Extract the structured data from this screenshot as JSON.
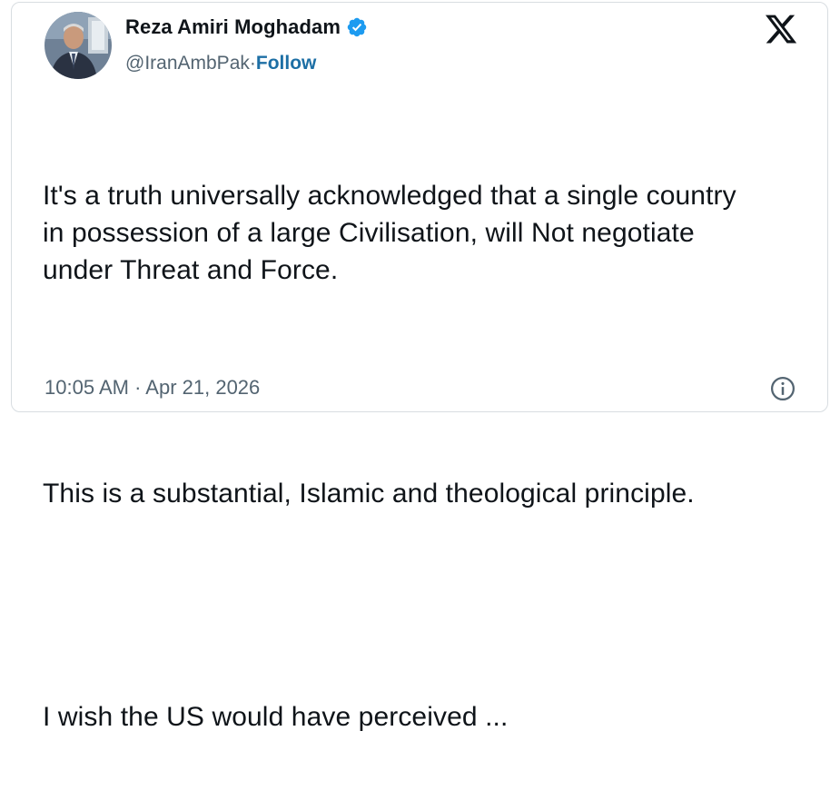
{
  "author": {
    "name": "Reza Amiri Moghadam",
    "handle": "@IranAmbPak",
    "separator": " · ",
    "follow_label": "Follow",
    "verified": true,
    "avatar_icon": "profile-photo"
  },
  "brand": {
    "logo_icon": "x-logo"
  },
  "tweet": {
    "paragraph_1": "It's a truth universally acknowledged that a single country\nin possession of a large Civilisation, will Not negotiate\nunder Threat and Force.",
    "paragraph_2": "This is a substantial, Islamic and theological principle.",
    "paragraph_3": "I wish the US would have perceived ..."
  },
  "meta": {
    "timestamp": "10:05 AM · Apr 21, 2026",
    "info_icon": "info-icon"
  },
  "colors": {
    "verified": "#1d9bf0",
    "follow_link": "#1d6fa5",
    "secondary_text": "#536471",
    "primary_text": "#0f1419",
    "border": "#d8dde1"
  }
}
